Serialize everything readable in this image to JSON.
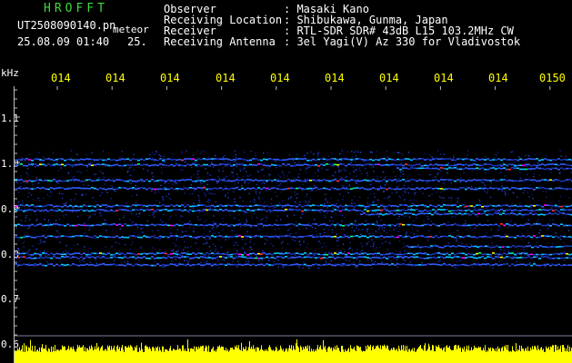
{
  "header": {
    "brand": "HROFFT",
    "filename": "UT2508090140.pn",
    "mode": "meteor",
    "datetime": "25.08.09 01:40",
    "extra": "25.",
    "info": [
      {
        "label": "Observer",
        "value": ": Masaki Kano"
      },
      {
        "label": "Receiving Location",
        "value": ": Shibukawa, Gunma, Japan"
      },
      {
        "label": "Receiver",
        "value": ": RTL-SDR SDR# 43dB L15 103.2MHz CW"
      },
      {
        "label": "Receiving Antenna",
        "value": ": 3el Yagi(V) Az 330 for Vladivostok"
      }
    ]
  },
  "time_axis": {
    "labels": [
      "014",
      "014",
      "014",
      "014",
      "014",
      "014",
      "014",
      "014",
      "014",
      "0150"
    ]
  },
  "freq_axis": {
    "unit": "kHz",
    "labels": [
      "1.1",
      "1.0",
      "0.9",
      "0.8",
      "0.7",
      "0.6"
    ]
  },
  "colors": {
    "background": "#000000",
    "brand": "#3ddc3d",
    "time_labels": "#ffff00",
    "signal": "#ffff00"
  }
}
